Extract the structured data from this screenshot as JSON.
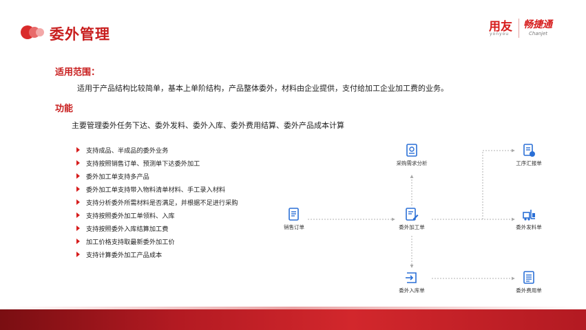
{
  "header": {
    "title": "委外管理",
    "brand_primary": "用友",
    "brand_primary_sub": "yonyou",
    "brand_secondary": "畅捷通",
    "brand_secondary_sub": "Chanjet"
  },
  "scope": {
    "label": "适用范围：",
    "text": "适用于产品结构比较简单，基本上单阶结构，产品整体委外，材料由企业提供，支付给加工企业加工费的业务。"
  },
  "functions": {
    "label": "功能",
    "text": "主要管理委外任务下达、委外发料、委外入库、委外费用结算、委外产品成本计算"
  },
  "features": [
    "支持成品、半成品的委外业务",
    "支持按照销售订单、预测单下达委外加工",
    "委外加工单支持多产品",
    "委外加工单支持带入物料清单材料、手工录入材料",
    "支持分析委外所需材料是否满足，并根据不足进行采购",
    "支持按照委外加工单领料、入库",
    "支持按照委外入库结算加工费",
    "加工价格支持取最新委外加工价",
    "支持计算委外加工产品成本"
  ],
  "flow": {
    "nodes": {
      "sales_order": "销售订单",
      "purchase_analysis": "采购需求分析",
      "outsource_order": "委外加工单",
      "outsource_receipt": "委外入库单",
      "work_report": "工序汇报单",
      "material_issue": "委外发料单",
      "outsource_expense": "委外费用单"
    }
  },
  "colors": {
    "accent": "#c81e1e",
    "icon_blue": "#2a6fd6",
    "arrow": "#b0b0b0",
    "footer": "#b31a22"
  }
}
